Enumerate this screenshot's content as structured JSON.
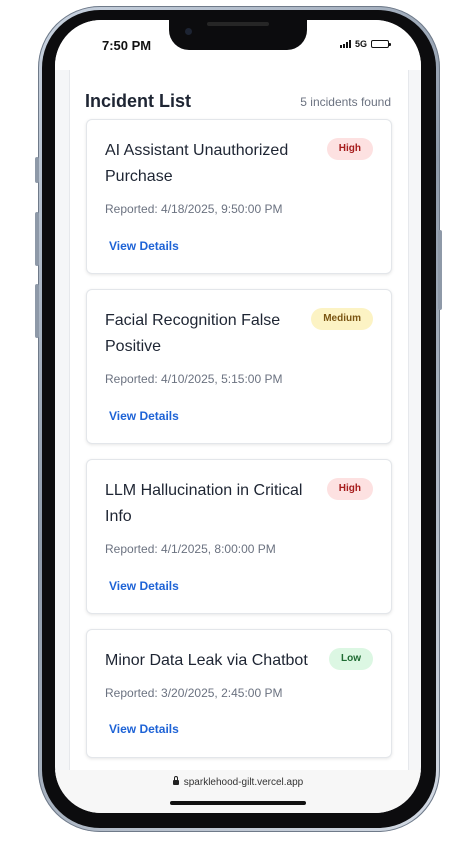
{
  "status": {
    "time": "7:50 PM",
    "network": "5G"
  },
  "list": {
    "title": "Incident List",
    "count": "5 incidents found"
  },
  "incidents": [
    {
      "title_line1": "AI Assistant Unauthorized",
      "title_line2": "Purchase",
      "severity": "High",
      "reported": "Reported: 4/18/2025, 9:50:00 PM",
      "link": "View Details"
    },
    {
      "title_line1": "Facial Recognition False",
      "title_line2": "Positive",
      "severity": "Medium",
      "reported": "Reported: 4/10/2025, 5:15:00 PM",
      "link": "View Details"
    },
    {
      "title_line1": "LLM Hallucination in Critical",
      "title_line2": "Info",
      "severity": "High",
      "reported": "Reported: 4/1/2025, 8:00:00 PM",
      "link": "View Details"
    },
    {
      "title_line1": "Minor Data Leak via Chatbot",
      "title_line2": "",
      "severity": "Low",
      "reported": "Reported: 3/20/2025, 2:45:00 PM",
      "link": "View Details"
    }
  ],
  "browser": {
    "url": "sparklehood-gilt.vercel.app"
  },
  "colors": {
    "link": "#1e63d6",
    "high_bg": "#fde1e1",
    "medium_bg": "#fcf3c4",
    "low_bg": "#dcf7e3"
  }
}
